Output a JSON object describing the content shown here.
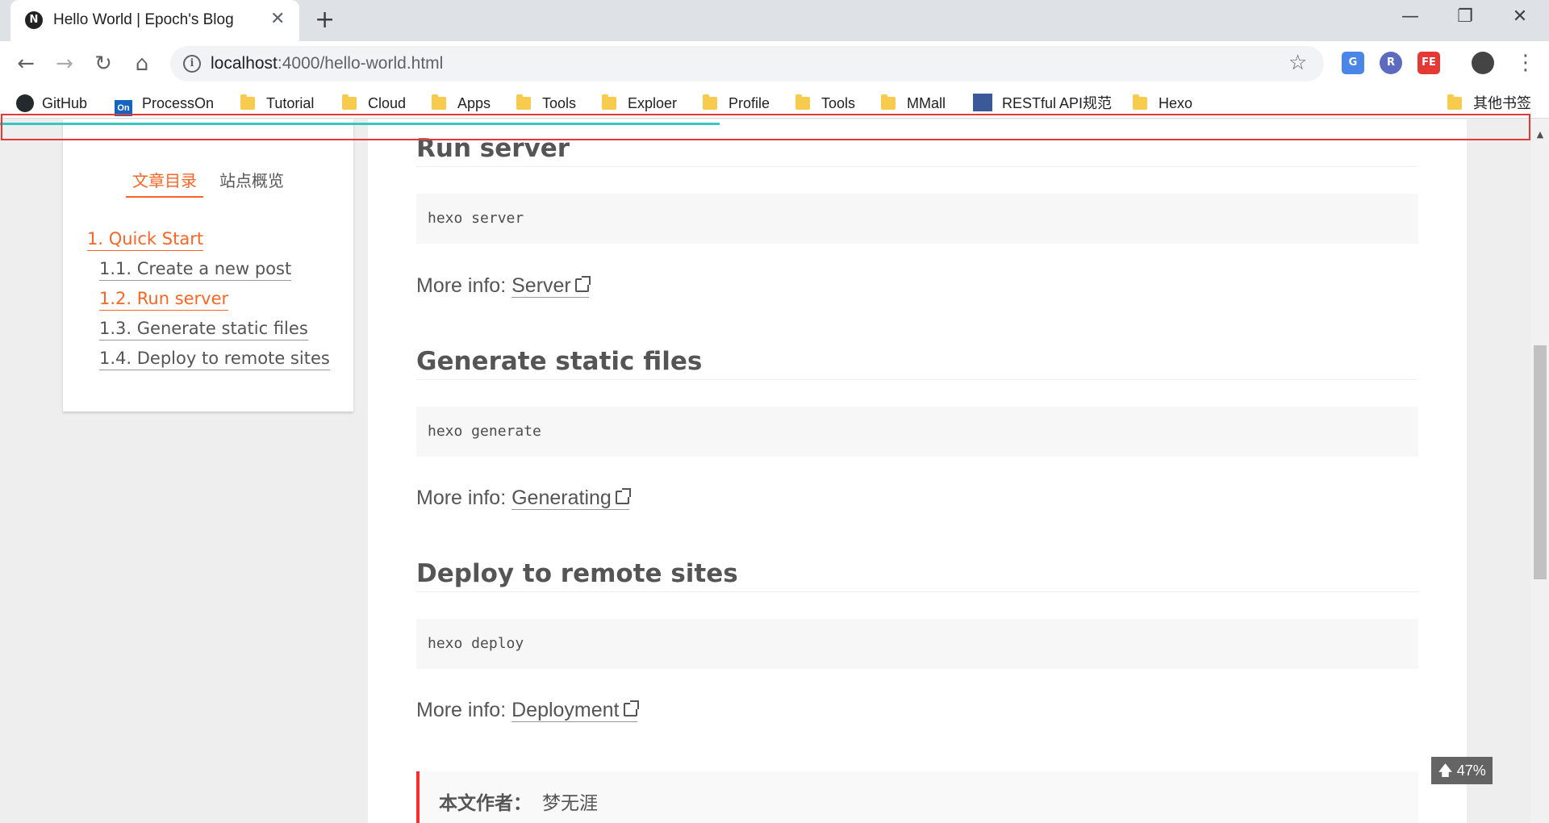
{
  "browser": {
    "tab_title": "Hello World | Epoch's Blog",
    "tab_favicon": "N",
    "url_host": "localhost",
    "url_path": ":4000/hello-world.html",
    "minimize": "—",
    "restore": "❐",
    "close": "✕"
  },
  "bookmarks": [
    "GitHub",
    "ProcessOn",
    "Tutorial",
    "Cloud",
    "Apps",
    "Tools",
    "Exploer",
    "Profile",
    "Tools",
    "MMall",
    "RESTful API规范",
    "Hexo",
    "其他书签"
  ],
  "extensions": {
    "translate": "G",
    "r": "R",
    "fe": "FE"
  },
  "sidebar": {
    "tabs": [
      "文章目录",
      "站点概览"
    ],
    "toc": [
      {
        "label": "1. Quick Start"
      },
      {
        "label": "1.1. Create a new post"
      },
      {
        "label": "1.2. Run server"
      },
      {
        "label": "1.3. Generate static files"
      },
      {
        "label": "1.4. Deploy to remote sites"
      }
    ]
  },
  "post": {
    "sections": [
      {
        "heading": "Run server",
        "code": "hexo server",
        "more_prefix": "More info: ",
        "link": "Server"
      },
      {
        "heading": "Generate static files",
        "code": "hexo generate",
        "more_prefix": "More info: ",
        "link": "Generating"
      },
      {
        "heading": "Deploy to remote sites",
        "code": "hexo deploy",
        "more_prefix": "More info: ",
        "link": "Deployment"
      }
    ],
    "copyright_label": "本文作者：",
    "copyright_value": "梦无涯"
  },
  "back_to_top": "47%",
  "reading_progress": 0.47,
  "colors": {
    "accent": "#fc6423",
    "progress": "#37c6c0",
    "highlight_box": "#e53935",
    "copyright_border": "#ff2a2a"
  }
}
